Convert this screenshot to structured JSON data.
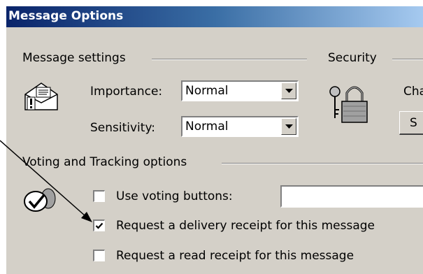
{
  "window": {
    "title": "Message Options"
  },
  "message_settings": {
    "group_label": "Message settings",
    "importance_label": "Importance:",
    "importance_value": "Normal",
    "sensitivity_label": "Sensitivity:",
    "sensitivity_value": "Normal"
  },
  "security": {
    "group_label": "Security",
    "change_settings_partial": "Cha",
    "button_partial": "S"
  },
  "voting": {
    "group_label": "Voting and Tracking options",
    "use_voting_label": "Use voting buttons:",
    "use_voting_checked": false,
    "use_voting_value": "",
    "delivery_receipt_label": "Request a delivery receipt for this message",
    "delivery_receipt_checked": true,
    "read_receipt_label": "Request a read receipt for this message",
    "read_receipt_checked": false
  },
  "icons": {
    "message_settings": "envelope-important-icon",
    "security": "padlock-keys-icon",
    "voting": "voting-check-icon",
    "combo_arrow": "chevron-down-icon",
    "annotation": "arrow-pointer-icon"
  },
  "colors": {
    "dialog_face": "#d4d0c8",
    "title_start": "#0a246a",
    "title_end": "#a6caf0",
    "title_text": "#ffffff"
  }
}
